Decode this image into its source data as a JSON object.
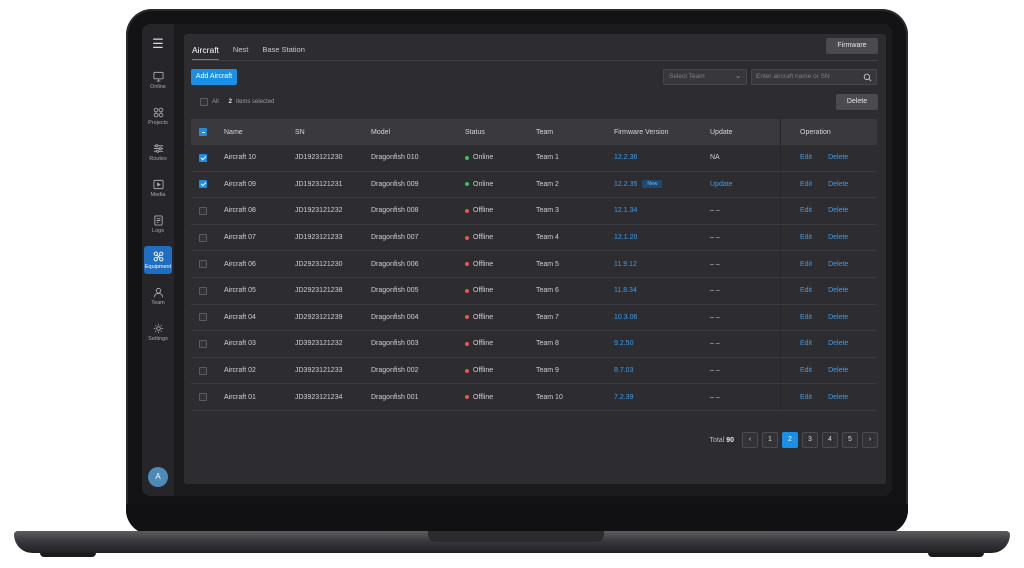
{
  "sidebar": {
    "items": [
      {
        "label": "Online",
        "icon": "monitor-icon"
      },
      {
        "label": "Projects",
        "icon": "grid-icon"
      },
      {
        "label": "Routes",
        "icon": "route-icon"
      },
      {
        "label": "Media",
        "icon": "media-icon"
      },
      {
        "label": "Logs",
        "icon": "log-icon"
      },
      {
        "label": "Equipment",
        "icon": "drone-icon",
        "active": true
      },
      {
        "label": "Team",
        "icon": "user-icon"
      },
      {
        "label": "Settings",
        "icon": "gear-icon"
      }
    ],
    "avatar": "A"
  },
  "tabs": [
    {
      "label": "Aircraft",
      "active": true
    },
    {
      "label": "Nest"
    },
    {
      "label": "Base Station"
    }
  ],
  "toolbar": {
    "firmware_label": "Firmware",
    "add_label": "Add Aircraft",
    "select_team_placeholder": "Select Team",
    "search_placeholder": "Enter aircraft name or SN",
    "all_label": "All",
    "selected_count": "2",
    "selected_suffix": "items selected",
    "delete_label": "Delete"
  },
  "table": {
    "headers": {
      "name": "Name",
      "sn": "SN",
      "model": "Model",
      "status": "Status",
      "team": "Team",
      "firmware": "Firmware Version",
      "update": "Update",
      "operation": "Operation"
    },
    "rows": [
      {
        "checked": true,
        "name": "Aircraft 10",
        "sn": "JD1923121230",
        "model": "Dragonfish 010",
        "status": "Online",
        "team": "Team 1",
        "firmware": "12.2.36",
        "badge": "",
        "update": "NA",
        "update_link": false
      },
      {
        "checked": true,
        "name": "Aircraft 09",
        "sn": "JD1923121231",
        "model": "Dragonfish 009",
        "status": "Online",
        "team": "Team 2",
        "firmware": "12.2.35",
        "badge": "New",
        "update": "Update",
        "update_link": true
      },
      {
        "checked": false,
        "name": "Aircraft 08",
        "sn": "JD1923121232",
        "model": "Dragonfish 008",
        "status": "Offline",
        "team": "Team 3",
        "firmware": "12.1.34",
        "badge": "",
        "update": "– –",
        "update_link": false
      },
      {
        "checked": false,
        "name": "Aircraft 07",
        "sn": "JD1923121233",
        "model": "Dragonfish 007",
        "status": "Offline",
        "team": "Team 4",
        "firmware": "12.1.20",
        "badge": "",
        "update": "– –",
        "update_link": false
      },
      {
        "checked": false,
        "name": "Aircraft 06",
        "sn": "JD2923121230",
        "model": "Dragonfish 006",
        "status": "Offline",
        "team": "Team 5",
        "firmware": "11.9.12",
        "badge": "",
        "update": "– –",
        "update_link": false
      },
      {
        "checked": false,
        "name": "Aircraft 05",
        "sn": "JD2923121238",
        "model": "Dragonfish 005",
        "status": "Offline",
        "team": "Team 6",
        "firmware": "11.8.34",
        "badge": "",
        "update": "– –",
        "update_link": false
      },
      {
        "checked": false,
        "name": "Aircraft 04",
        "sn": "JD2923121239",
        "model": "Dragonfish 004",
        "status": "Offline",
        "team": "Team 7",
        "firmware": "10.3.06",
        "badge": "",
        "update": "– –",
        "update_link": false
      },
      {
        "checked": false,
        "name": "Aircraft 03",
        "sn": "JD3923121232",
        "model": "Dragonfish 003",
        "status": "Offline",
        "team": "Team 8",
        "firmware": "9.2.50",
        "badge": "",
        "update": "– –",
        "update_link": false
      },
      {
        "checked": false,
        "name": "Aircraft 02",
        "sn": "JD3923121233",
        "model": "Dragonfish 002",
        "status": "Offline",
        "team": "Team 9",
        "firmware": "8.7.03",
        "badge": "",
        "update": "– –",
        "update_link": false
      },
      {
        "checked": false,
        "name": "Aircraft 01",
        "sn": "JD3923121234",
        "model": "Dragonfish 001",
        "status": "Offline",
        "team": "Team 10",
        "firmware": "7.2.39",
        "badge": "",
        "update": "– –",
        "update_link": false
      }
    ],
    "op_edit": "Edit",
    "op_delete": "Delete"
  },
  "pagination": {
    "total_label": "Total",
    "total": "90",
    "pages": [
      "1",
      "2",
      "3",
      "4",
      "5"
    ],
    "current": "2"
  },
  "colors": {
    "accent": "#1990e8",
    "online": "#3cc05a",
    "offline": "#e8584a",
    "link": "#3d9be9"
  }
}
